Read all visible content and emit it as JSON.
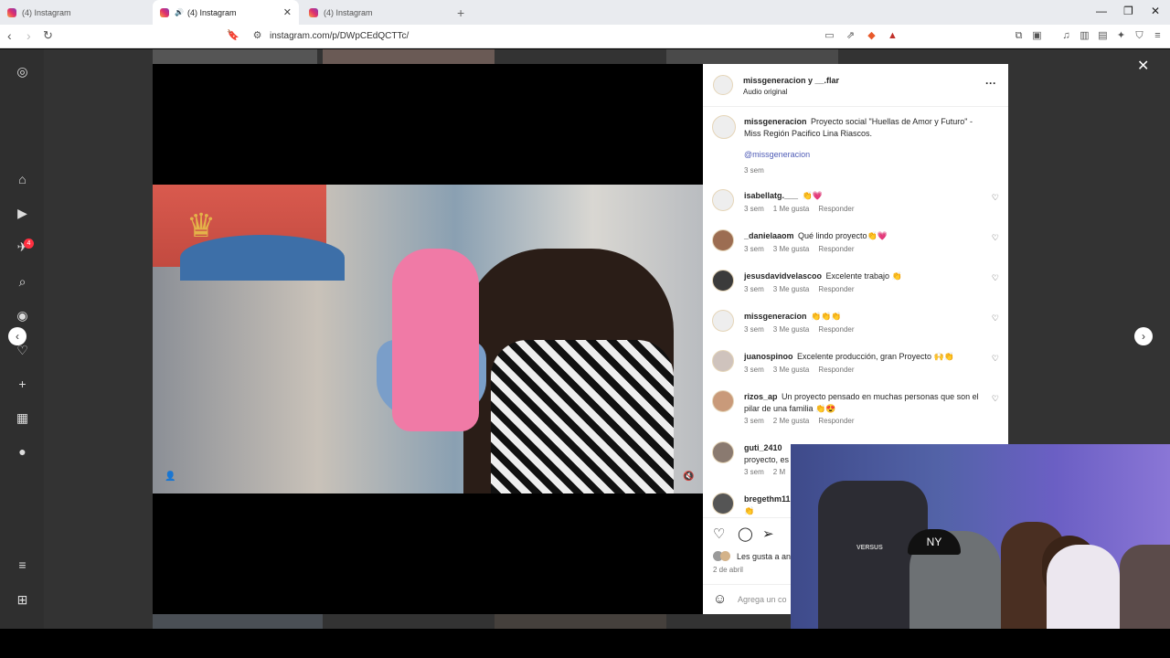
{
  "browser": {
    "tabs": [
      {
        "title": "(4) Instagram"
      },
      {
        "title": "(4) Instagram"
      },
      {
        "title": "(4) Instagram"
      }
    ],
    "url": "instagram.com/p/DWpCEdQCTTc/"
  },
  "sidebar": {
    "notification_count": "4"
  },
  "post": {
    "header": {
      "usernames": "missgeneracion y __.flar",
      "audio": "Audio original"
    },
    "caption": {
      "username": "missgeneracion",
      "text": "Proyecto social \"Huellas de Amor y Futuro\" - Miss Región Pacifico Lina Riascos.",
      "mention": "@missgeneracion",
      "time": "3 sem"
    },
    "comments": [
      {
        "username": "isabellatg.___",
        "text": "👏💗",
        "time": "3 sem",
        "likes": "1 Me gusta",
        "reply": "Responder"
      },
      {
        "username": "_danielaaom",
        "text": "Qué lindo proyecto👏💗",
        "time": "3 sem",
        "likes": "3 Me gusta",
        "reply": "Responder"
      },
      {
        "username": "jesusdavidvelascoo",
        "text": "Excelente trabajo 👏",
        "time": "3 sem",
        "likes": "3 Me gusta",
        "reply": "Responder"
      },
      {
        "username": "missgeneracion",
        "text": "👏👏👏",
        "time": "3 sem",
        "likes": "3 Me gusta",
        "reply": "Responder"
      },
      {
        "username": "juanospinoo",
        "text": "Excelente producción, gran Proyecto 🙌👏",
        "time": "3 sem",
        "likes": "3 Me gusta",
        "reply": "Responder"
      },
      {
        "username": "rizos_ap",
        "text": "Un proyecto pensado en muchas personas que son el pilar de una familia 👏😍",
        "time": "3 sem",
        "likes": "2 Me gusta",
        "reply": "Responder"
      },
      {
        "username": "guti_2410",
        "text": "proyecto, es",
        "time": "3 sem",
        "likes": "2 M",
        "reply": ""
      },
      {
        "username": "bregethm11",
        "text": "👏",
        "time": "",
        "likes": "",
        "reply": ""
      }
    ],
    "likes_text": "Les gusta a an",
    "date": "2 de abril",
    "add_comment_placeholder": "Agrega un co"
  },
  "webcam": {
    "cap_logo": "NY",
    "chair_brand": "VERSUS"
  }
}
